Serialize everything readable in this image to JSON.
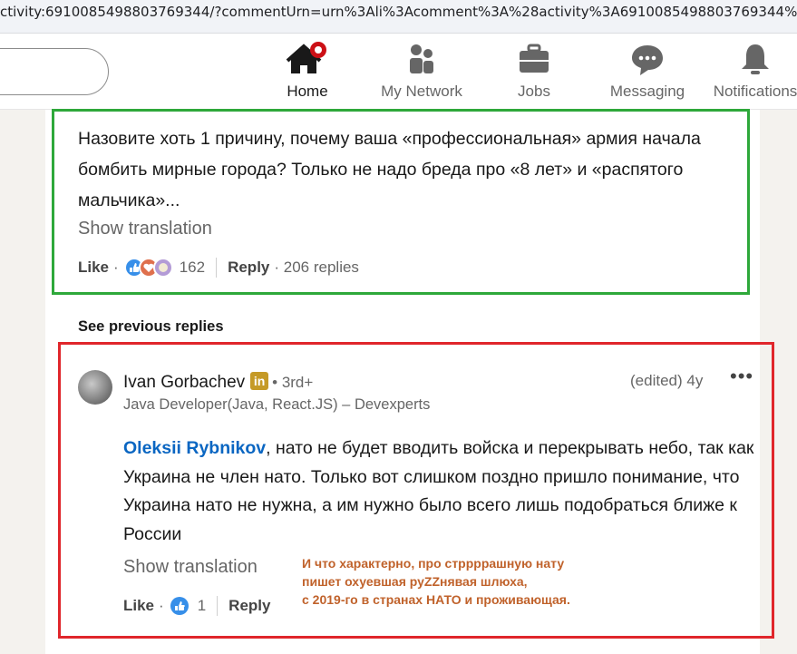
{
  "browser": {
    "url": "ctivity:6910085498803769344/?commentUrn=urn%3Ali%3Acomment%3A%28activity%3A6910085498803769344%"
  },
  "nav": {
    "items": [
      {
        "label": "Home",
        "icon": "home-icon",
        "active": true
      },
      {
        "label": "My Network",
        "icon": "network-icon"
      },
      {
        "label": "Jobs",
        "icon": "briefcase-icon"
      },
      {
        "label": "Messaging",
        "icon": "messaging-icon"
      },
      {
        "label": "Notifications",
        "icon": "bell-icon"
      }
    ]
  },
  "comment1": {
    "text": "Назовите хоть 1 причину, почему ваша «профессиональная» армия начала бомбить мирные города? Только не надо бреда про «8 лет» и «распятого мальчика»...",
    "show_translation": "Show translation",
    "like": "Like",
    "dot": "·",
    "reaction_count": "162",
    "reply": "Reply",
    "replies": "· 206 replies"
  },
  "see_previous": "See previous replies",
  "comment2": {
    "author": "Ivan Gorbachev",
    "badge": "in",
    "degree": "• 3rd+",
    "headline": "Java Developer(Java, React.JS) – Devexperts",
    "meta": "(edited) 4y",
    "more": "•••",
    "mention": "Oleksii Rybnikov",
    "text": ", нато не будет вводить войска и перекрывать небо, так как Украина не член нато. Только вот слишком поздно пришло понимание, что Украина нато не нужна, а им нужно было всего лишь подобраться ближе к России",
    "show_translation": "Show translation",
    "like": "Like",
    "dot": "·",
    "reaction_count": "1",
    "reply": "Reply"
  },
  "annotation": {
    "line1": "И что характерно, про стррррашную нату",
    "line2": "пишет охуевшая руZZнявая шлюха,",
    "line3": "с 2019-го в странах НАТО и проживающая."
  },
  "colors": {
    "green_box": "#2ea83a",
    "red_box": "#e0262b",
    "link": "#0a66c2",
    "annotation": "#c0622b"
  }
}
